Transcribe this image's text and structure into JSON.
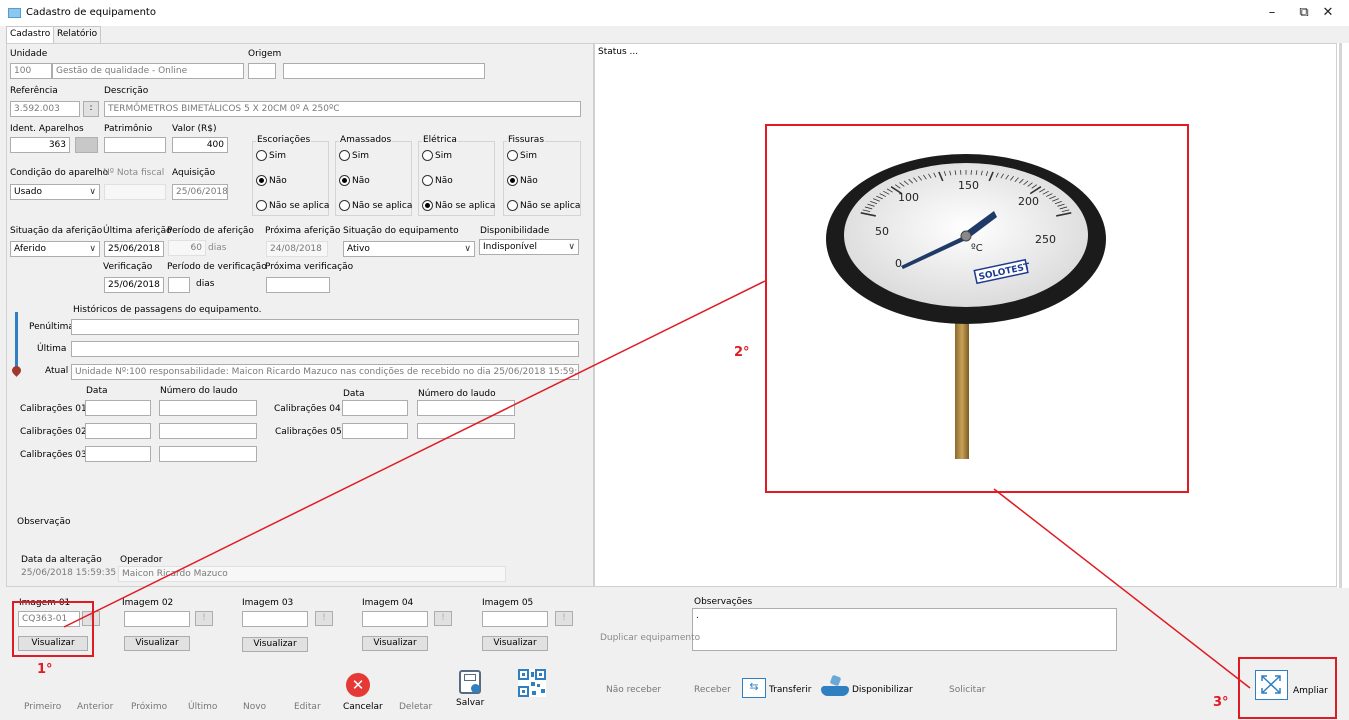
{
  "window": {
    "title": "Cadastro de equipamento",
    "minimize": "–",
    "restore": "⧉",
    "close": "✕"
  },
  "tabs": [
    "Cadastro",
    "Relatório"
  ],
  "form": {
    "unidade_label": "Unidade",
    "unidade_code": "100",
    "unidade_name": "Gestão de qualidade - Online",
    "origem_label": "Origem",
    "referencia_label": "Referência",
    "referencia": "3.592.003",
    "ref_btn": ":",
    "descricao_label": "Descrição",
    "descricao": "TERMÔMETROS BIMETÁLICOS 5 X 20CM 0º A 250ºC",
    "ident_label": "Ident. Aparelhos",
    "ident": "363",
    "patrimonio_label": "Patrimônio",
    "valor_label": "Valor (R$)",
    "valor": "400",
    "condicao_label": "Condição do aparelho",
    "condicao": "Usado",
    "nota_label": "Nº Nota fiscal",
    "aquisicao_label": "Aquisição",
    "aquisicao": "25/06/2018",
    "groups": [
      {
        "title": "Escoriações",
        "options": [
          "Sim",
          "Não",
          "Não se aplica"
        ],
        "selected": 1
      },
      {
        "title": "Amassados",
        "options": [
          "Sim",
          "Não",
          "Não se aplica"
        ],
        "selected": 1
      },
      {
        "title": "Elétrica",
        "options": [
          "Sim",
          "Não",
          "Não se aplica"
        ],
        "selected": 2
      },
      {
        "title": "Fissuras",
        "options": [
          "Sim",
          "Não",
          "Não se aplica"
        ],
        "selected": 1
      }
    ],
    "situacao_afericao_label": "Situação da aferição",
    "situacao_afericao": "Aferido",
    "ultima_afericao_label": "Última aferição",
    "ultima_afericao": "25/06/2018",
    "periodo_afericao_label": "Período de aferição",
    "periodo_afericao": "60",
    "dias": "dias",
    "proxima_afericao_label": "Próxima aferição",
    "proxima_afericao": "24/08/2018",
    "situacao_equip_label": "Situação do equipamento",
    "situacao_equip": "Ativo",
    "disponibilidade_label": "Disponibilidade",
    "disponibilidade": "Indisponível",
    "verificacao_label": "Verificação",
    "verificacao": "25/06/2018",
    "periodo_verificacao_label": "Período de verificação",
    "dias2": "dias",
    "proxima_verificacao_label": "Próxima verificação",
    "historicos_label": "Históricos de passagens do equipamento.",
    "penultima_label": "Penúltima",
    "ultima_label": "Última",
    "atual_label": "Atual",
    "atual": "Unidade Nº:100 responsabilidade: Maicon Ricardo Mazuco nas condições de recebido no dia 25/06/2018 15:59:35",
    "data_label": "Data",
    "laudo_label": "Número do laudo",
    "cal01": "Calibrações 01",
    "cal02": "Calibrações 02",
    "cal03": "Calibrações 03",
    "cal04": "Calibrações 04",
    "cal05": "Calibrações 05",
    "observacao_label": "Observação",
    "data_alteracao_label": "Data da alteração",
    "data_alteracao": "25/06/2018 15:59:35",
    "operador_label": "Operador",
    "operador": "Maicon Ricardo Mazuco"
  },
  "status": "Status ...",
  "images": {
    "labels": [
      "Imagem 01",
      "Imagem 02",
      "Imagem 03",
      "Imagem 04",
      "Imagem 05"
    ],
    "img01_value": "CQ363-01",
    "small_btn": "!",
    "view_btn": "Visualizar",
    "obs_label": "Observações",
    "obs_value": ".",
    "duplicar": "Duplicar equipamento"
  },
  "toolbar": {
    "primeiro": "Primeiro",
    "anterior": "Anterior",
    "proximo": "Próximo",
    "ultimo": "Último",
    "novo": "Novo",
    "editar": "Editar",
    "cancelar": "Cancelar",
    "deletar": "Deletar",
    "salvar": "Salvar",
    "nao_receber": "Não receber",
    "receber": "Receber",
    "transferir": "Transferir",
    "disponibilizar": "Disponibilizar",
    "solicitar": "Solicitar",
    "ampliar": "Ampliar"
  },
  "gauge": {
    "ticks": [
      "0",
      "50",
      "100",
      "150",
      "200",
      "250"
    ],
    "unit": "ºC",
    "brand": "SOLOTEST"
  },
  "annotations": {
    "n1": "1°",
    "n2": "2°",
    "n3": "3°"
  },
  "colors": {
    "annotation": "#e01b24",
    "cancel": "#e53935",
    "accent": "#2f7fc1"
  }
}
